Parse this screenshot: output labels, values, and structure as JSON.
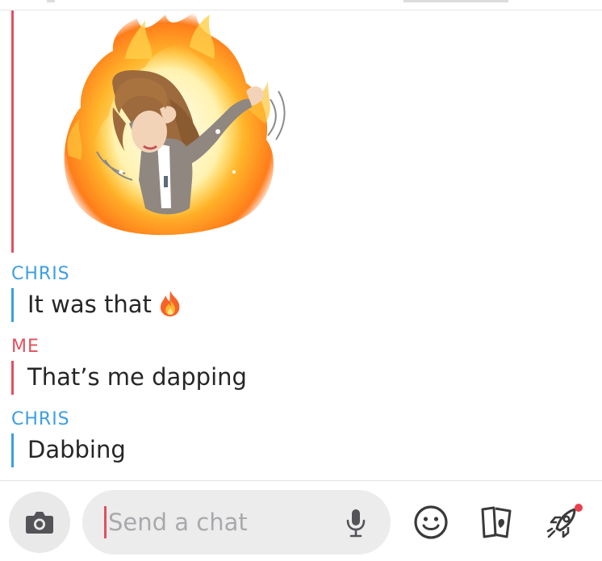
{
  "messages": [
    {
      "sender": "CHRIS",
      "text": "It was that",
      "emoji": "fire-emoji"
    },
    {
      "sender": "ME",
      "text": "That’s me dapping"
    },
    {
      "sender": "CHRIS",
      "text": "Dabbing"
    }
  ],
  "sticker": {
    "icon": "bitmoji-dab-fire-sticker"
  },
  "compose": {
    "placeholder": "Send a chat",
    "icons": [
      "camera-icon",
      "microphone-icon",
      "smiley-icon",
      "cards-icon",
      "rocket-icon"
    ]
  },
  "colors": {
    "chris": "#3c9ee5",
    "me": "#e2505e",
    "text": "#262626",
    "placeholder": "#a9a9ad",
    "notification_dot": "#e8414e"
  }
}
